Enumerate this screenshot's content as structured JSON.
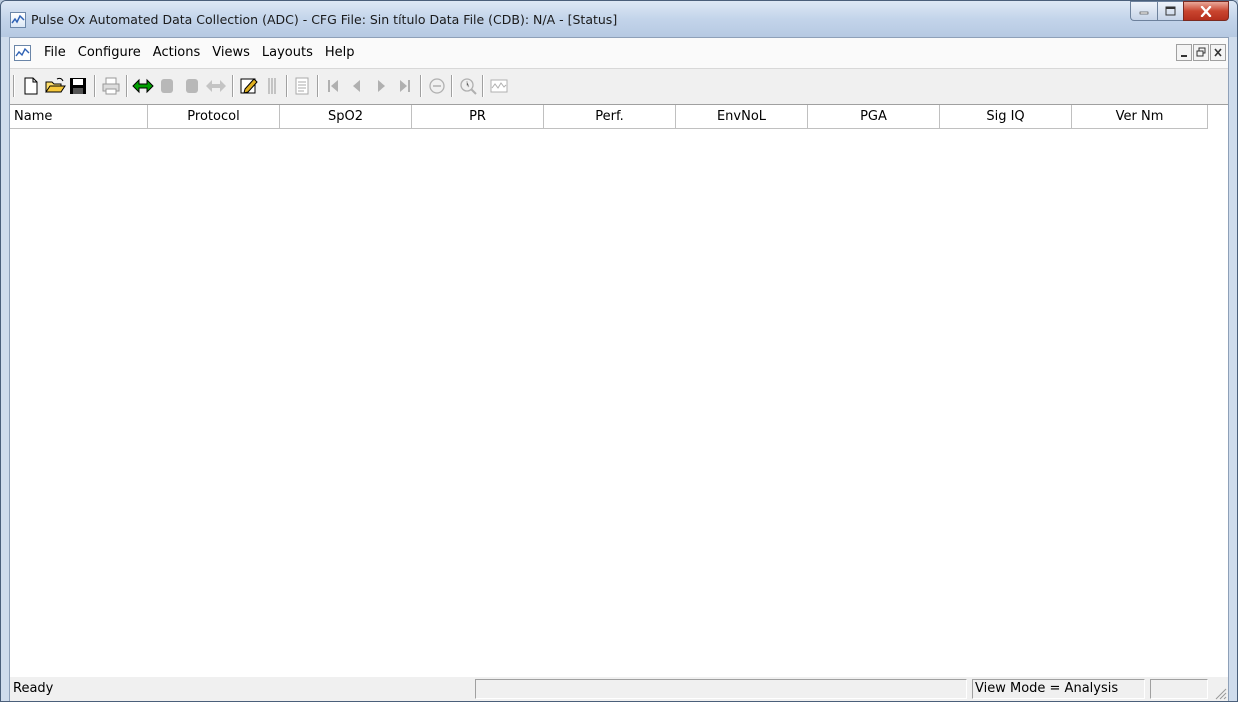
{
  "window": {
    "title": "Pulse Ox Automated Data Collection (ADC) - CFG File:  Sin título     Data File (CDB):  N/A - [Status]",
    "controls": {
      "minimize": "minimize-icon",
      "maximize": "maximize-icon",
      "close": "close-icon"
    }
  },
  "menu": {
    "items": [
      "File",
      "Configure",
      "Actions",
      "Views",
      "Layouts",
      "Help"
    ],
    "child_controls": [
      "child-minimize-icon",
      "child-restore-icon",
      "child-close-icon"
    ]
  },
  "toolbar": {
    "buttons": [
      {
        "icon": "new-file-icon",
        "enabled": true
      },
      {
        "icon": "open-folder-icon",
        "enabled": true
      },
      {
        "icon": "save-icon",
        "enabled": true
      },
      {
        "icon": "print-icon",
        "enabled": false
      },
      {
        "icon": "connect-arrows-icon",
        "enabled": true,
        "color": "#00a000"
      },
      {
        "icon": "record-icon",
        "enabled": false
      },
      {
        "icon": "stop-icon",
        "enabled": false
      },
      {
        "icon": "disconnect-arrows-icon",
        "enabled": false
      },
      {
        "icon": "edit-notes-icon",
        "enabled": true
      },
      {
        "icon": "markers-icon",
        "enabled": false
      },
      {
        "icon": "document-icon",
        "enabled": false
      },
      {
        "icon": "first-record-icon",
        "enabled": false
      },
      {
        "icon": "previous-record-icon",
        "enabled": false
      },
      {
        "icon": "next-record-icon",
        "enabled": false
      },
      {
        "icon": "last-record-icon",
        "enabled": false
      },
      {
        "icon": "remove-icon",
        "enabled": false
      },
      {
        "icon": "zoom-icon",
        "enabled": false
      },
      {
        "icon": "waveform-icon",
        "enabled": false
      }
    ]
  },
  "grid": {
    "columns": [
      "Name",
      "Protocol",
      "SpO2",
      "PR",
      "Perf.",
      "EnvNoL",
      "PGA",
      "Sig IQ",
      "Ver Nm"
    ]
  },
  "statusbar": {
    "message": "Ready",
    "view_mode": "View Mode = Analysis"
  },
  "colors": {
    "accent_green": "#00a000",
    "close_red": "#c9452f"
  }
}
